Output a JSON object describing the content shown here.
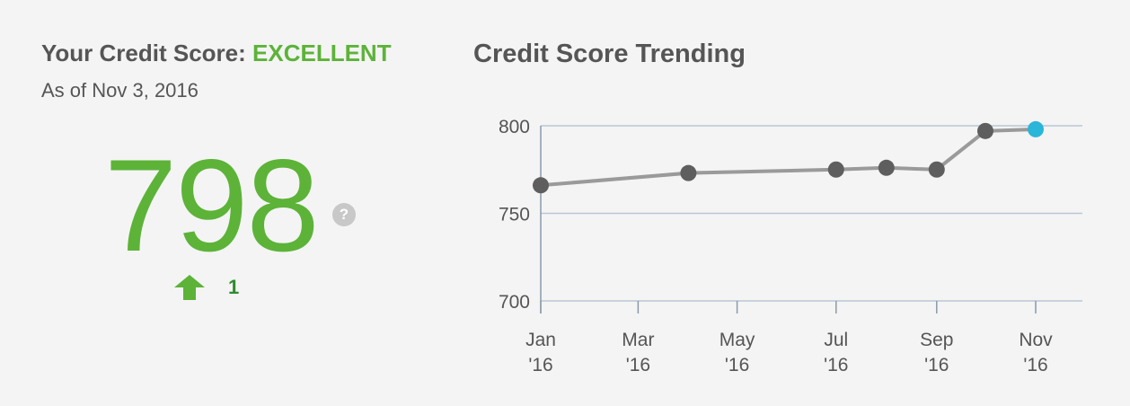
{
  "score_panel": {
    "title_prefix": "Your Credit Score:",
    "rating": "EXCELLENT",
    "as_of": "As of Nov 3, 2016",
    "score": "798",
    "help_glyph": "?",
    "change": "1",
    "change_direction_icon": "up-arrow-icon",
    "colors": {
      "score": "#5cb338",
      "change": "#2e8b2e"
    }
  },
  "chart_data": {
    "type": "line",
    "title": "Credit Score Trending",
    "xlabel": "",
    "ylabel": "",
    "y_ticks": [
      "800",
      "750",
      "700"
    ],
    "ylim": [
      700,
      800
    ],
    "x_tick_labels": [
      [
        "Jan",
        "'16"
      ],
      [
        "Mar",
        "'16"
      ],
      [
        "May",
        "'16"
      ],
      [
        "Jul",
        "'16"
      ],
      [
        "Sep",
        "'16"
      ],
      [
        "Nov",
        "'16"
      ]
    ],
    "x_domain": [
      "2016-01-01",
      "2016-11-01"
    ],
    "grid": true,
    "series": [
      {
        "points": [
          {
            "x": "2016-01-01",
            "y": 766
          },
          {
            "x": "2016-04-01",
            "y": 773
          },
          {
            "x": "2016-07-01",
            "y": 775
          },
          {
            "x": "2016-08-01",
            "y": 776
          },
          {
            "x": "2016-09-01",
            "y": 775
          },
          {
            "x": "2016-10-01",
            "y": 797
          },
          {
            "x": "2016-11-01",
            "y": 798
          }
        ]
      }
    ],
    "colors": {
      "line": "#9a9a9a",
      "point": "#5e5e5e",
      "latest_point": "#29b6d8",
      "grid": "#b9c7d4",
      "axis": "#8a9aa8"
    }
  }
}
